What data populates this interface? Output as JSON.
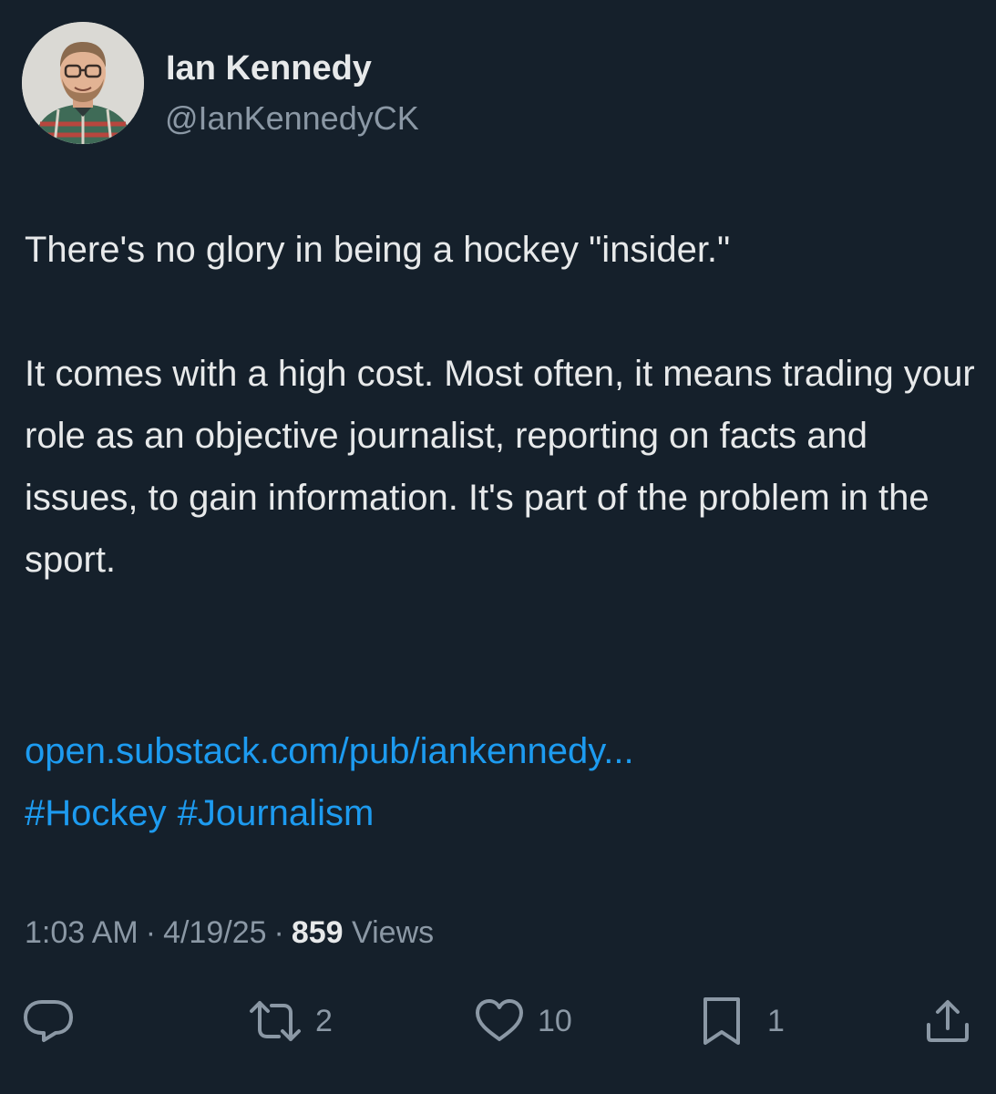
{
  "author": {
    "name": "Ian Kennedy",
    "handle": "@IanKennedyCK",
    "avatar_icon": "profile-photo"
  },
  "tweet": {
    "paragraph1": "There's no glory in being a hockey \"insider.\"",
    "paragraph2": "It comes with a high cost. Most often, it means trading your role as an objective journalist, reporting on facts and issues, to gain information. It's part of the problem in the sport.",
    "link": "open.substack.com/pub/iankennedy...",
    "hashtags": [
      "#Hockey",
      "#Journalism"
    ]
  },
  "meta": {
    "time": "1:03 AM",
    "separator": "·",
    "date": "4/19/25",
    "views_count": "859",
    "views_label": "Views"
  },
  "actions": {
    "reply_icon": "reply-icon",
    "retweet_count": "2",
    "like_count": "10",
    "bookmark_count": "1",
    "share_icon": "share-icon"
  },
  "colors": {
    "background": "#15202b",
    "text": "#e7e9ea",
    "secondary": "#8b98a5",
    "link": "#1d9bf0"
  }
}
